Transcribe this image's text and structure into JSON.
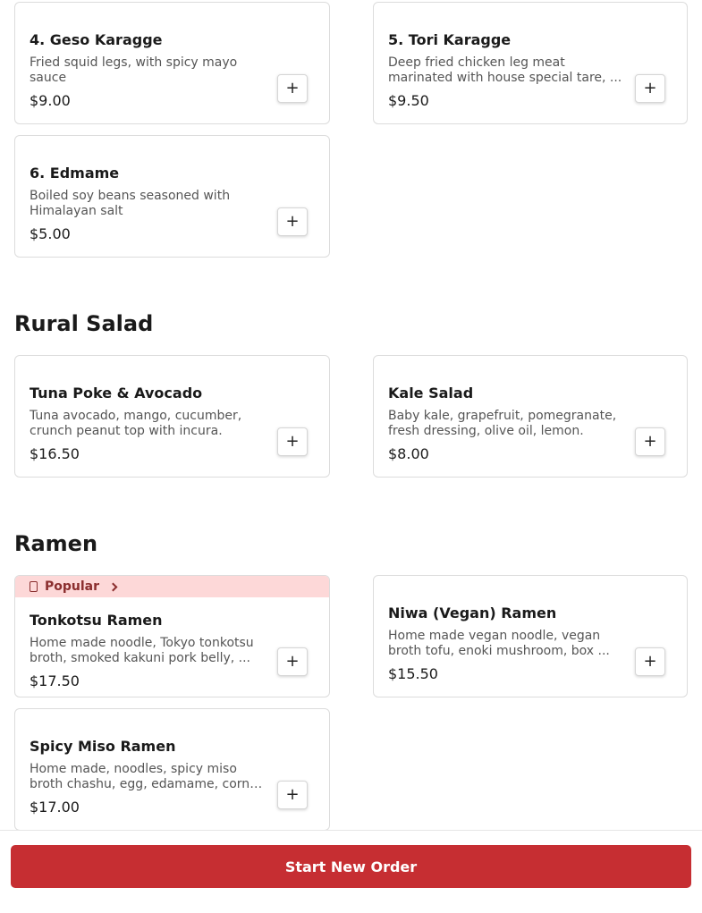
{
  "sections": {
    "appetizers": {
      "items": [
        {
          "name": "4. Geso Karagge",
          "description": "Fried squid legs, with spicy mayo sauce",
          "price": "$9.00"
        },
        {
          "name": "5. Tori Karagge",
          "description": "Deep fried chicken leg meat marinated with house special tare, ...",
          "price": "$9.50"
        },
        {
          "name": "6. Edmame",
          "description": "Boiled soy beans seasoned with Himalayan salt",
          "price": "$5.00"
        }
      ]
    },
    "salad": {
      "title": "Rural Salad",
      "items": [
        {
          "name": "Tuna Poke & Avocado",
          "description": "Tuna avocado, mango, cucumber, crunch peanut top with incura.",
          "price": "$16.50"
        },
        {
          "name": "Kale Salad",
          "description": "Baby kale, grapefruit, pomegranate, fresh dressing, olive oil, lemon.",
          "price": "$8.00"
        }
      ]
    },
    "ramen": {
      "title": "Ramen",
      "items": [
        {
          "name": "Tonkotsu Ramen",
          "description": "Home made noodle, Tokyo tonkotsu broth, smoked kakuni pork belly, ...",
          "price": "$17.50",
          "badge": "Popular"
        },
        {
          "name": "Niwa (Vegan) Ramen",
          "description": "Home made vegan noodle, vegan broth tofu, enoki mushroom, box ...",
          "price": "$15.50"
        },
        {
          "name": "Spicy Miso Ramen",
          "description": "Home made, noodles, spicy miso broth chashu, egg, edamame, corn ...",
          "price": "$17.00"
        }
      ]
    }
  },
  "add_button": {
    "label": "+"
  },
  "footer": {
    "button_label": "Start New Order"
  },
  "colors": {
    "accent": "#c62e32",
    "badge_bg": "#fdd8d8",
    "badge_text": "#8b2e2e"
  }
}
